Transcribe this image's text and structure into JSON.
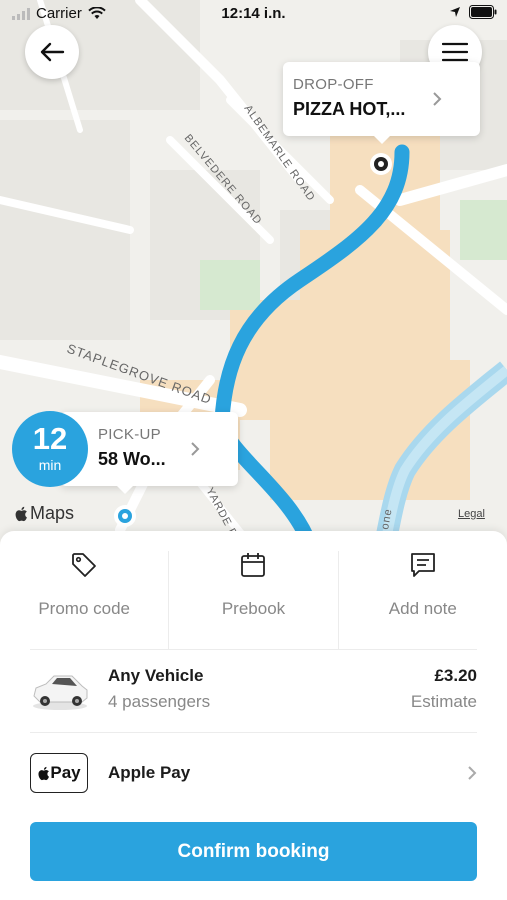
{
  "status_bar": {
    "carrier": "Carrier",
    "time": "12:14 i.n."
  },
  "map": {
    "street_labels": [
      "BELVEDERE ROAD",
      "ALBEMARLE ROAD",
      "STAPLEGROVE ROAD",
      "YARDE PL",
      "one"
    ],
    "dropoff": {
      "kicker": "DROP-OFF",
      "value": "PIZZA HOT,..."
    },
    "pickup": {
      "kicker": "PICK-UP",
      "value": "58 Wo..."
    },
    "eta": {
      "number": "12",
      "unit": "min"
    },
    "maps_logo": "Maps",
    "legal": "Legal",
    "route_color": "#2aa3de"
  },
  "actions": [
    {
      "label": "Promo code",
      "icon": "tag-icon"
    },
    {
      "label": "Prebook",
      "icon": "calendar-icon"
    },
    {
      "label": "Add note",
      "icon": "note-icon"
    }
  ],
  "vehicle": {
    "title": "Any Vehicle",
    "subtitle": "4 passengers",
    "price": "£3.20",
    "price_note": "Estimate"
  },
  "payment": {
    "badge": "Pay",
    "label": "Apple Pay"
  },
  "confirm_label": "Confirm booking",
  "colors": {
    "accent": "#2aa3de"
  }
}
